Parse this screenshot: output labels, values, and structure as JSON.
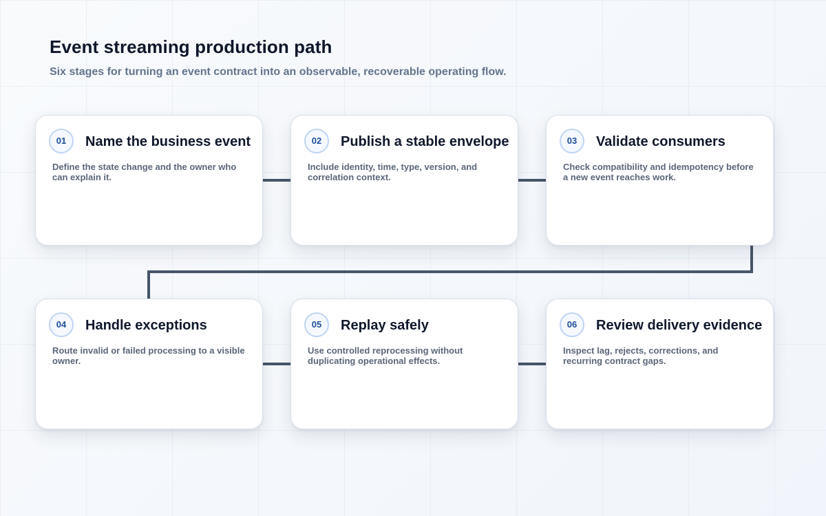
{
  "header": {
    "title": "Event streaming production path",
    "subtitle": "Six stages for turning an event contract into an observable, recoverable operating flow."
  },
  "stages": [
    {
      "number": "01",
      "title": "Name the business event",
      "description": "Define the state change and the owner who can explain it."
    },
    {
      "number": "02",
      "title": "Publish a stable envelope",
      "description": "Include identity, time, type, version, and correlation context."
    },
    {
      "number": "03",
      "title": "Validate consumers",
      "description": "Check compatibility and idempotency before a new event reaches work."
    },
    {
      "number": "04",
      "title": "Handle exceptions",
      "description": "Route invalid or failed processing to a visible owner."
    },
    {
      "number": "05",
      "title": "Replay safely",
      "description": "Use controlled reprocessing without duplicating operational effects."
    },
    {
      "number": "06",
      "title": "Review delivery evidence",
      "description": "Inspect lag, rejects, corrections, and recurring contract gaps."
    }
  ],
  "colors": {
    "connector": "#475569",
    "number_text": "#1f4f9a",
    "number_border": "#bfd3f4",
    "card_border": "#d8e0ea",
    "title_text": "#0f172a",
    "description_text": "#5b6678"
  }
}
